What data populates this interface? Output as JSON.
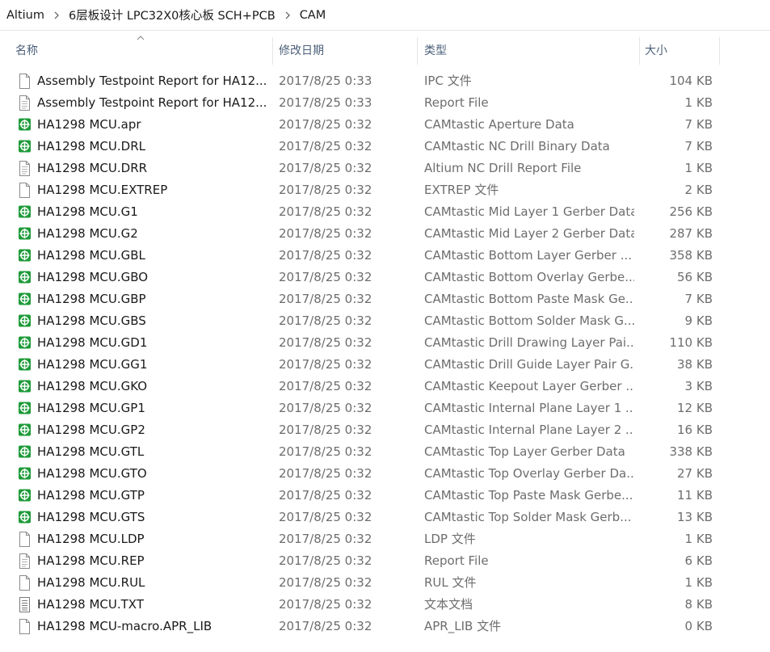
{
  "breadcrumb": [
    "Altium",
    "6层板设计 LPC32X0核心板 SCH+PCB",
    "CAM"
  ],
  "columns": {
    "name": "名称",
    "date": "修改日期",
    "type": "类型",
    "size": "大小"
  },
  "files": [
    {
      "name": "Assembly Testpoint Report for HA12...",
      "date": "2017/8/25 0:33",
      "type": "IPC 文件",
      "size": "104 KB",
      "icon": "blank-file-icon"
    },
    {
      "name": "Assembly Testpoint Report for HA12...",
      "date": "2017/8/25 0:33",
      "type": "Report File",
      "size": "1 KB",
      "icon": "report-file-icon"
    },
    {
      "name": "HA1298 MCU.apr",
      "date": "2017/8/25 0:32",
      "type": "CAMtastic Aperture Data",
      "size": "7 KB",
      "icon": "camtastic-file-icon"
    },
    {
      "name": "HA1298 MCU.DRL",
      "date": "2017/8/25 0:32",
      "type": "CAMtastic NC Drill Binary Data",
      "size": "7 KB",
      "icon": "camtastic-file-icon"
    },
    {
      "name": "HA1298 MCU.DRR",
      "date": "2017/8/25 0:32",
      "type": "Altium NC Drill Report File",
      "size": "1 KB",
      "icon": "report-file-icon"
    },
    {
      "name": "HA1298 MCU.EXTREP",
      "date": "2017/8/25 0:32",
      "type": "EXTREP 文件",
      "size": "2 KB",
      "icon": "blank-file-icon"
    },
    {
      "name": "HA1298 MCU.G1",
      "date": "2017/8/25 0:32",
      "type": "CAMtastic Mid Layer 1 Gerber Data",
      "size": "256 KB",
      "icon": "camtastic-file-icon"
    },
    {
      "name": "HA1298 MCU.G2",
      "date": "2017/8/25 0:32",
      "type": "CAMtastic Mid Layer 2 Gerber Data",
      "size": "287 KB",
      "icon": "camtastic-file-icon"
    },
    {
      "name": "HA1298 MCU.GBL",
      "date": "2017/8/25 0:32",
      "type": "CAMtastic Bottom Layer Gerber ...",
      "size": "358 KB",
      "icon": "camtastic-file-icon"
    },
    {
      "name": "HA1298 MCU.GBO",
      "date": "2017/8/25 0:32",
      "type": "CAMtastic Bottom Overlay Gerbe...",
      "size": "56 KB",
      "icon": "camtastic-file-icon"
    },
    {
      "name": "HA1298 MCU.GBP",
      "date": "2017/8/25 0:32",
      "type": "CAMtastic Bottom Paste Mask Ge...",
      "size": "7 KB",
      "icon": "camtastic-file-icon"
    },
    {
      "name": "HA1298 MCU.GBS",
      "date": "2017/8/25 0:32",
      "type": "CAMtastic Bottom Solder Mask G...",
      "size": "9 KB",
      "icon": "camtastic-file-icon"
    },
    {
      "name": "HA1298 MCU.GD1",
      "date": "2017/8/25 0:32",
      "type": "CAMtastic Drill Drawing Layer Pai...",
      "size": "110 KB",
      "icon": "camtastic-file-icon"
    },
    {
      "name": "HA1298 MCU.GG1",
      "date": "2017/8/25 0:32",
      "type": "CAMtastic Drill Guide Layer Pair G...",
      "size": "38 KB",
      "icon": "camtastic-file-icon"
    },
    {
      "name": "HA1298 MCU.GKO",
      "date": "2017/8/25 0:32",
      "type": "CAMtastic Keepout Layer Gerber ...",
      "size": "3 KB",
      "icon": "camtastic-file-icon"
    },
    {
      "name": "HA1298 MCU.GP1",
      "date": "2017/8/25 0:32",
      "type": "CAMtastic Internal Plane Layer 1 ...",
      "size": "12 KB",
      "icon": "camtastic-file-icon"
    },
    {
      "name": "HA1298 MCU.GP2",
      "date": "2017/8/25 0:32",
      "type": "CAMtastic Internal Plane Layer 2 ...",
      "size": "16 KB",
      "icon": "camtastic-file-icon"
    },
    {
      "name": "HA1298 MCU.GTL",
      "date": "2017/8/25 0:32",
      "type": "CAMtastic Top Layer Gerber Data",
      "size": "338 KB",
      "icon": "camtastic-file-icon"
    },
    {
      "name": "HA1298 MCU.GTO",
      "date": "2017/8/25 0:32",
      "type": "CAMtastic Top Overlay Gerber Da...",
      "size": "27 KB",
      "icon": "camtastic-file-icon"
    },
    {
      "name": "HA1298 MCU.GTP",
      "date": "2017/8/25 0:32",
      "type": "CAMtastic Top Paste Mask Gerbe...",
      "size": "11 KB",
      "icon": "camtastic-file-icon"
    },
    {
      "name": "HA1298 MCU.GTS",
      "date": "2017/8/25 0:32",
      "type": "CAMtastic Top Solder Mask Gerb...",
      "size": "13 KB",
      "icon": "camtastic-file-icon"
    },
    {
      "name": "HA1298 MCU.LDP",
      "date": "2017/8/25 0:32",
      "type": "LDP 文件",
      "size": "1 KB",
      "icon": "blank-file-icon"
    },
    {
      "name": "HA1298 MCU.REP",
      "date": "2017/8/25 0:32",
      "type": "Report File",
      "size": "6 KB",
      "icon": "report-file-icon"
    },
    {
      "name": "HA1298 MCU.RUL",
      "date": "2017/8/25 0:32",
      "type": "RUL 文件",
      "size": "1 KB",
      "icon": "blank-file-icon"
    },
    {
      "name": "HA1298 MCU.TXT",
      "date": "2017/8/25 0:32",
      "type": "文本文档",
      "size": "8 KB",
      "icon": "text-file-icon"
    },
    {
      "name": "HA1298 MCU-macro.APR_LIB",
      "date": "2017/8/25 0:32",
      "type": "APR_LIB 文件",
      "size": "0 KB",
      "icon": "blank-file-icon"
    }
  ],
  "colors": {
    "header_text": "#4c607a",
    "secondary_text": "#6d6d6d",
    "camtastic_green": "#1f9b3a"
  }
}
